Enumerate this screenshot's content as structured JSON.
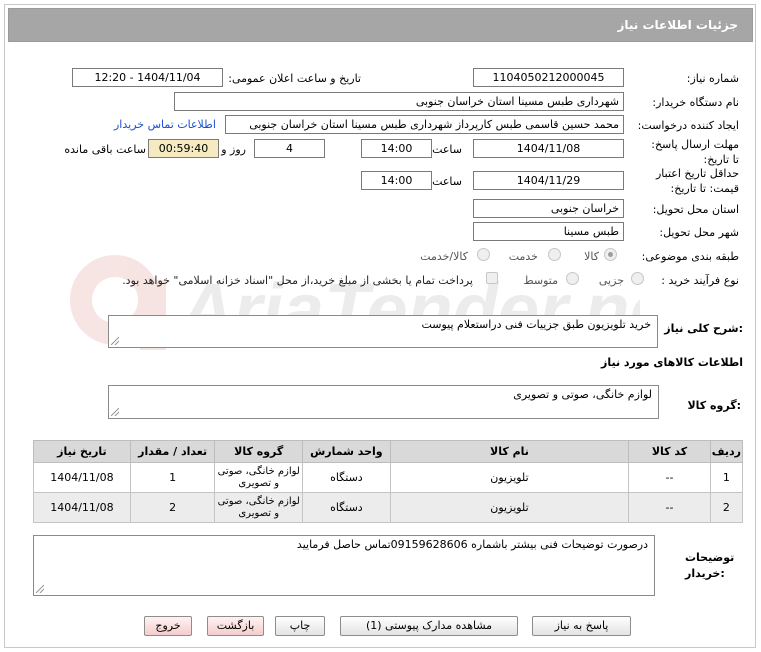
{
  "header": {
    "title": "جزئیات اطلاعات نیاز"
  },
  "form": {
    "need_number_label": "شماره نیاز:",
    "need_number": "1104050212000045",
    "announce_label": "تاریخ و ساعت اعلان عمومی:",
    "announce_value": "1404/11/04 - 12:20",
    "buyer_org_label": "نام دستگاه خریدار:",
    "buyer_org": "شهرداری طبس مسینا استان خراسان جنوبی",
    "creator_label": "ایجاد کننده درخواست:",
    "creator": "محمد حسین قاسمی طبس کارپرداز شهرداری طبس مسینا استان خراسان جنوبی",
    "contact_link": "اطلاعات تماس خریدار",
    "reply_deadline_label": "مهلت ارسال پاسخ: تا تاریخ:",
    "reply_date": "1404/11/08",
    "time_label": "ساعت",
    "reply_time": "14:00",
    "days_value": "4",
    "days_label": "روز و",
    "remaining_time": "00:59:40",
    "remaining_label": "ساعت باقی مانده",
    "validity_label": "حداقل تاریخ اعتبار قیمت: تا تاریخ:",
    "validity_date": "1404/11/29",
    "validity_time": "14:00",
    "delivery_province_label": "استان محل تحویل:",
    "delivery_province": "خراسان جنوبی",
    "delivery_city_label": "شهر محل تحویل:",
    "delivery_city": "طبس مسینا",
    "category_label": "طبقه بندی موضوعی:",
    "category_options": [
      "کالا",
      "خدمت",
      "کالا/خدمت"
    ],
    "process_label": "نوع فرآیند خرید :",
    "process_options": [
      "جزیی",
      "متوسط"
    ],
    "payment_note": "پرداخت تمام یا بخشی از مبلغ خرید،از محل \"اسناد خزانه اسلامی\" خواهد بود."
  },
  "description": {
    "label": "شرح کلی نیاز:",
    "text": "خرید تلویزیون طبق جزییات فنی دراستعلام پیوست"
  },
  "goods": {
    "section_title": "اطلاعات کالاهای مورد نیاز",
    "group_label": "گروه کالا:",
    "group_value": "لوازم خانگی، صوتی و تصویری"
  },
  "table": {
    "headers": [
      "ردیف",
      "کد کالا",
      "نام کالا",
      "واحد شمارش",
      "گروه کالا",
      "تعداد / مقدار",
      "تاریخ نیاز"
    ],
    "rows": [
      [
        "1",
        "--",
        "تلویزیون",
        "دستگاه",
        "لوازم خانگی، صوتی و تصویری",
        "1",
        "1404/11/08"
      ],
      [
        "2",
        "--",
        "تلویزیون",
        "دستگاه",
        "لوازم خانگی، صوتی و تصویری",
        "2",
        "1404/11/08"
      ]
    ]
  },
  "buyer_notes": {
    "label": "توضیحات خریدار:",
    "text": "درصورت توضیحات فنی بیشتر باشماره 09159628606تماس حاصل فرمایید"
  },
  "buttons": {
    "reply": "پاسخ به نیاز",
    "view_docs": "مشاهده مدارک پیوستی (1)",
    "print": "چاپ",
    "back": "بازگشت",
    "exit": "خروج"
  },
  "watermark": {
    "text": "AriaTender.net"
  },
  "colors": {
    "header_bg": "#a6a6a6",
    "link": "#1a4fd1",
    "timer_bg": "#f5eac0",
    "table_header": "#d9d9d9"
  }
}
